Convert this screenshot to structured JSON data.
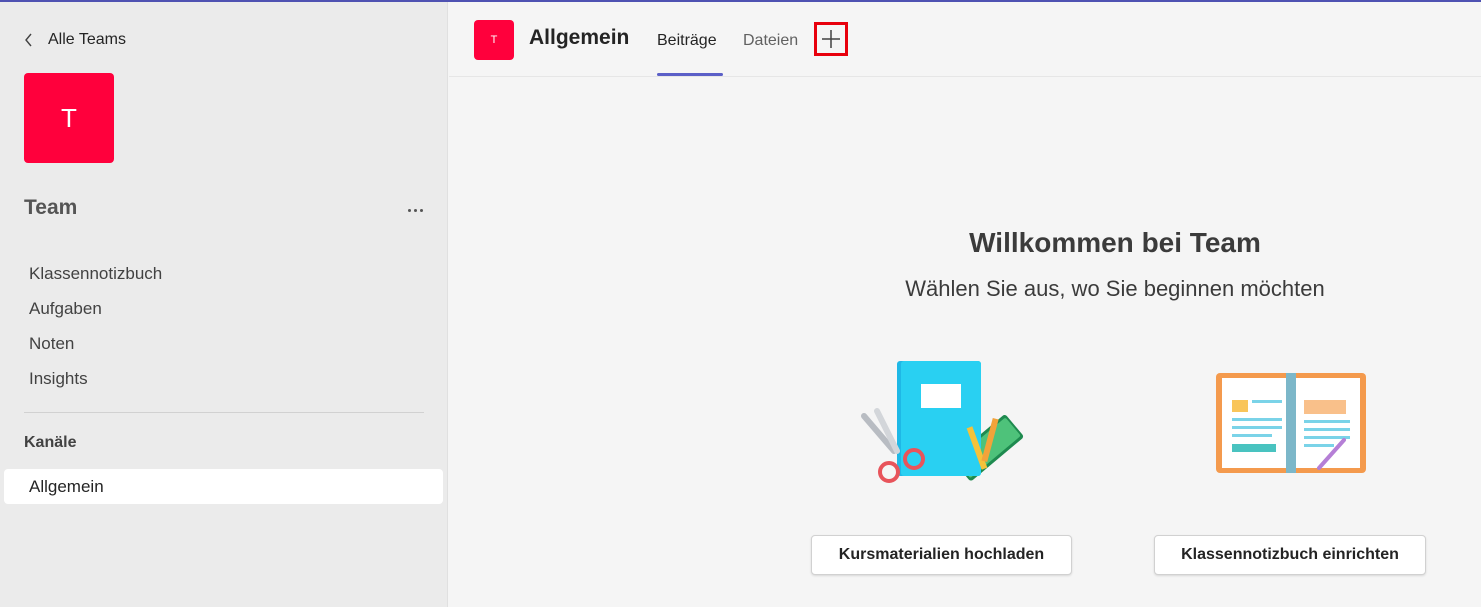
{
  "sidebar": {
    "back_label": "Alle Teams",
    "team_initial": "T",
    "team_name": "Team",
    "more_label": "...",
    "nav_items": [
      {
        "label": "Klassennotizbuch"
      },
      {
        "label": "Aufgaben"
      },
      {
        "label": "Noten"
      },
      {
        "label": "Insights"
      }
    ],
    "channels_title": "Kanäle",
    "channels": [
      {
        "label": "Allgemein",
        "selected": true
      }
    ]
  },
  "header": {
    "channel_initial": "T",
    "channel_name": "Allgemein",
    "tabs": [
      {
        "label": "Beiträge",
        "active": true
      },
      {
        "label": "Dateien",
        "active": false
      }
    ],
    "add_tab_icon": "plus-icon"
  },
  "main": {
    "title": "Willkommen bei Team",
    "subtitle": "Wählen Sie aus, wo Sie beginnen möchten",
    "actions": [
      {
        "label": "Kursmaterialien hochladen",
        "illustration": "notebook-scissors-illustration"
      },
      {
        "label": "Klassennotizbuch einrichten",
        "illustration": "open-notebook-illustration"
      }
    ]
  },
  "colors": {
    "accent": "#5b5fc7",
    "team_avatar": "#ff003c",
    "highlight_box": "#e8000d"
  }
}
